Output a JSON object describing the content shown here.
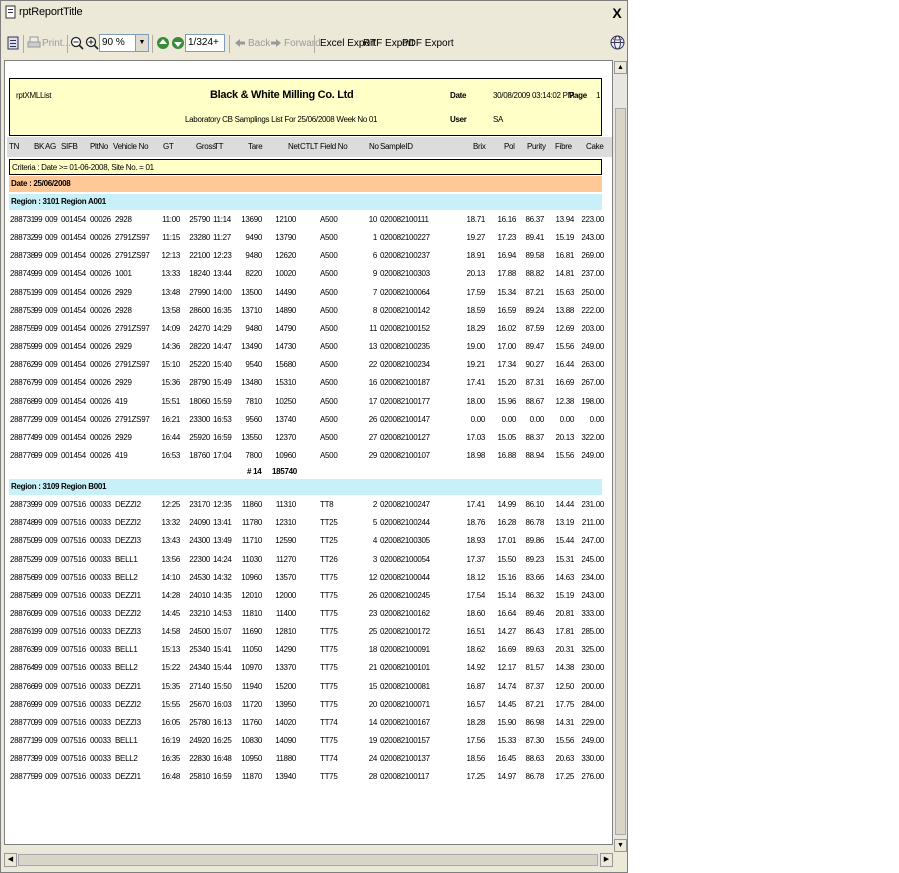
{
  "window": {
    "title": "rptReportTitle",
    "close_glyph": "X"
  },
  "toolbar": {
    "print_label": "Print...",
    "zoom_value": "90 %",
    "page_value": "1/324+",
    "back_label": "Back",
    "forward_label": "Forward",
    "excel_label": "Excel Export",
    "rtf_label": "RTF Export",
    "pdf_label": "PDF Export"
  },
  "report": {
    "code": "rptXMLList",
    "company": "Black & White Milling Co. Ltd",
    "subtitle": "Laboratory CB Samplings List For 25/06/2008 Week No 01",
    "date_label": "Date",
    "date_value": "30/08/2009 03:14:02 PM",
    "page_label": "Page",
    "page_value": "1",
    "user_label": "User",
    "user_value": "SA",
    "columns": [
      "TN",
      "BK",
      "AG",
      "SIFB",
      "PltNo",
      "Vehicle No",
      "GT",
      "Gross",
      "TT",
      "Tare",
      "Net",
      "CT",
      "LT",
      "Field No",
      "No",
      "SampleID",
      "Brix",
      "Pol",
      "Purity",
      "Fibre",
      "Cake"
    ],
    "criteria": "Criteria : Date >= 01-06-2008, Site No. = 01",
    "date_group": "Date : 25/06/2008",
    "regions": [
      {
        "title": "Region : 3101 Region A001",
        "rows": [
          [
            "288731",
            "99",
            "009",
            "001454",
            "00026",
            "2928",
            "11:00",
            "25790",
            "11:14",
            "13690",
            "12100",
            "A500",
            "10",
            "020082100111",
            "18.71",
            "16.16",
            "86.37",
            "13.94",
            "223.00"
          ],
          [
            "288732",
            "99",
            "009",
            "001454",
            "00026",
            "2791ZS97",
            "11:15",
            "23280",
            "11:27",
            "9490",
            "13790",
            "A500",
            "1",
            "020082100227",
            "19.27",
            "17.23",
            "89.41",
            "15.19",
            "243.00"
          ],
          [
            "288738",
            "99",
            "009",
            "001454",
            "00026",
            "2791ZS97",
            "12:13",
            "22100",
            "12:23",
            "9480",
            "12620",
            "A500",
            "6",
            "020082100237",
            "18.91",
            "16.94",
            "89.58",
            "16.81",
            "269.00"
          ],
          [
            "288749",
            "99",
            "009",
            "001454",
            "00026",
            "1001",
            "13:33",
            "18240",
            "13:44",
            "8220",
            "10020",
            "A500",
            "9",
            "020082100303",
            "20.13",
            "17.88",
            "88.82",
            "14.81",
            "237.00"
          ],
          [
            "288751",
            "99",
            "009",
            "001454",
            "00026",
            "2929",
            "13:48",
            "27990",
            "14:00",
            "13500",
            "14490",
            "A500",
            "7",
            "020082100064",
            "17.59",
            "15.34",
            "87.21",
            "15.63",
            "250.00"
          ],
          [
            "288753",
            "99",
            "009",
            "001454",
            "00026",
            "2928",
            "13:58",
            "28600",
            "16:35",
            "13710",
            "14890",
            "A500",
            "8",
            "020082100142",
            "18.59",
            "16.59",
            "89.24",
            "13.88",
            "222.00"
          ],
          [
            "288755",
            "99",
            "009",
            "001454",
            "00026",
            "2791ZS97",
            "14:09",
            "24270",
            "14:29",
            "9480",
            "14790",
            "A500",
            "11",
            "020082100152",
            "18.29",
            "16.02",
            "87.59",
            "12.69",
            "203.00"
          ],
          [
            "288759",
            "99",
            "009",
            "001454",
            "00026",
            "2929",
            "14:36",
            "28220",
            "14:47",
            "13490",
            "14730",
            "A500",
            "13",
            "020082100235",
            "19.00",
            "17.00",
            "89.47",
            "15.56",
            "249.00"
          ],
          [
            "288762",
            "99",
            "009",
            "001454",
            "00026",
            "2791ZS97",
            "15:10",
            "25220",
            "15:40",
            "9540",
            "15680",
            "A500",
            "22",
            "020082100234",
            "19.21",
            "17.34",
            "90.27",
            "16.44",
            "263.00"
          ],
          [
            "288767",
            "99",
            "009",
            "001454",
            "00026",
            "2929",
            "15:36",
            "28790",
            "15:49",
            "13480",
            "15310",
            "A500",
            "16",
            "020082100187",
            "17.41",
            "15.20",
            "87.31",
            "16.69",
            "267.00"
          ],
          [
            "288768",
            "99",
            "009",
            "001454",
            "00026",
            "419",
            "15:51",
            "18060",
            "15:59",
            "7810",
            "10250",
            "A500",
            "17",
            "020082100177",
            "18.00",
            "15.96",
            "88.67",
            "12.38",
            "198.00"
          ],
          [
            "288772",
            "99",
            "009",
            "001454",
            "00026",
            "2791ZS97",
            "16:21",
            "23300",
            "16:53",
            "9560",
            "13740",
            "A500",
            "26",
            "020082100147",
            "0.00",
            "0.00",
            "0.00",
            "0.00",
            "0.00"
          ],
          [
            "288774",
            "99",
            "009",
            "001454",
            "00026",
            "2929",
            "16:44",
            "25920",
            "16:59",
            "13550",
            "12370",
            "A500",
            "27",
            "020082100127",
            "17.03",
            "15.05",
            "88.37",
            "20.13",
            "322.00"
          ],
          [
            "288776",
            "99",
            "009",
            "001454",
            "00026",
            "419",
            "16:53",
            "18760",
            "17:04",
            "7800",
            "10960",
            "A500",
            "29",
            "020082100107",
            "18.98",
            "16.88",
            "88.94",
            "15.56",
            "249.00"
          ]
        ],
        "total_count": "# 14",
        "total_net": "185740"
      },
      {
        "title": "Region : 3109 Region B001",
        "rows": [
          [
            "288739",
            "99",
            "009",
            "007516",
            "00033",
            "DEZZI2",
            "12:25",
            "23170",
            "12:35",
            "11860",
            "11310",
            "TT8",
            "2",
            "020082100247",
            "17.41",
            "14.99",
            "86.10",
            "14.44",
            "231.00"
          ],
          [
            "288748",
            "99",
            "009",
            "007516",
            "00033",
            "DEZZI2",
            "13:32",
            "24090",
            "13:41",
            "11780",
            "12310",
            "TT25",
            "5",
            "020082100244",
            "18.76",
            "16.28",
            "86.78",
            "13.19",
            "211.00"
          ],
          [
            "288750",
            "99",
            "009",
            "007516",
            "00033",
            "DEZZI3",
            "13:43",
            "24300",
            "13:49",
            "11710",
            "12590",
            "TT25",
            "4",
            "020082100305",
            "18.93",
            "17.01",
            "89.86",
            "15.44",
            "247.00"
          ],
          [
            "288752",
            "99",
            "009",
            "007516",
            "00033",
            "BELL1",
            "13:56",
            "22300",
            "14:24",
            "11030",
            "11270",
            "TT26",
            "3",
            "020082100054",
            "17.37",
            "15.50",
            "89.23",
            "15.31",
            "245.00"
          ],
          [
            "288756",
            "99",
            "009",
            "007516",
            "00033",
            "BELL2",
            "14:10",
            "24530",
            "14:32",
            "10960",
            "13570",
            "TT75",
            "12",
            "020082100044",
            "18.12",
            "15.16",
            "83.66",
            "14.63",
            "234.00"
          ],
          [
            "288758",
            "99",
            "009",
            "007516",
            "00033",
            "DEZZI1",
            "14:28",
            "24010",
            "14:35",
            "12010",
            "12000",
            "TT75",
            "26",
            "020082100245",
            "17.54",
            "15.14",
            "86.32",
            "15.19",
            "243.00"
          ],
          [
            "288760",
            "99",
            "009",
            "007516",
            "00033",
            "DEZZI2",
            "14:45",
            "23210",
            "14:53",
            "11810",
            "11400",
            "TT75",
            "23",
            "020082100162",
            "18.60",
            "16.64",
            "89.46",
            "20.81",
            "333.00"
          ],
          [
            "288761",
            "99",
            "009",
            "007516",
            "00033",
            "DEZZI3",
            "14:58",
            "24500",
            "15:07",
            "11690",
            "12810",
            "TT75",
            "25",
            "020082100172",
            "16.51",
            "14.27",
            "86.43",
            "17.81",
            "285.00"
          ],
          [
            "288763",
            "99",
            "009",
            "007516",
            "00033",
            "BELL1",
            "15:13",
            "25340",
            "15:41",
            "11050",
            "14290",
            "TT75",
            "18",
            "020082100091",
            "18.62",
            "16.69",
            "89.63",
            "20.31",
            "325.00"
          ],
          [
            "288764",
            "99",
            "009",
            "007516",
            "00033",
            "BELL2",
            "15:22",
            "24340",
            "15:44",
            "10970",
            "13370",
            "TT75",
            "21",
            "020082100101",
            "14.92",
            "12.17",
            "81.57",
            "14.38",
            "230.00"
          ],
          [
            "288766",
            "99",
            "009",
            "007516",
            "00033",
            "DEZZI1",
            "15:35",
            "27140",
            "15:50",
            "11940",
            "15200",
            "TT75",
            "15",
            "020082100081",
            "16.87",
            "14.74",
            "87.37",
            "12.50",
            "200.00"
          ],
          [
            "288769",
            "99",
            "009",
            "007516",
            "00033",
            "DEZZI2",
            "15:55",
            "25670",
            "16:03",
            "11720",
            "13950",
            "TT75",
            "20",
            "020082100071",
            "16.57",
            "14.45",
            "87.21",
            "17.75",
            "284.00"
          ],
          [
            "288770",
            "99",
            "009",
            "007516",
            "00033",
            "DEZZI3",
            "16:05",
            "25780",
            "16:13",
            "11760",
            "14020",
            "TT74",
            "14",
            "020082100167",
            "18.28",
            "15.90",
            "86.98",
            "14.31",
            "229.00"
          ],
          [
            "288771",
            "99",
            "009",
            "007516",
            "00033",
            "BELL1",
            "16:19",
            "24920",
            "16:25",
            "10830",
            "14090",
            "TT75",
            "19",
            "020082100157",
            "17.56",
            "15.33",
            "87.30",
            "15.56",
            "249.00"
          ],
          [
            "288773",
            "99",
            "009",
            "007516",
            "00033",
            "BELL2",
            "16:35",
            "22830",
            "16:48",
            "10950",
            "11880",
            "TT74",
            "24",
            "020082100137",
            "18.56",
            "16.45",
            "88.63",
            "20.63",
            "330.00"
          ],
          [
            "288775",
            "99",
            "009",
            "007516",
            "00033",
            "DEZZI1",
            "16:48",
            "25810",
            "16:59",
            "11870",
            "13940",
            "TT75",
            "28",
            "020082100117",
            "17.25",
            "14.97",
            "86.78",
            "17.25",
            "276.00"
          ]
        ]
      }
    ]
  },
  "colors": {
    "header_bg": "#ffffc8",
    "date_band": "#ffc896",
    "region_band": "#c8f0f8",
    "colhdr_bg": "#dcdcdc"
  },
  "icons": [
    "app-icon",
    "toc-icon",
    "print-icon",
    "zoom-out-icon",
    "zoom-in-icon",
    "prev-page-icon",
    "next-page-icon",
    "back-arrow-icon",
    "forward-arrow-icon",
    "globe-icon"
  ]
}
